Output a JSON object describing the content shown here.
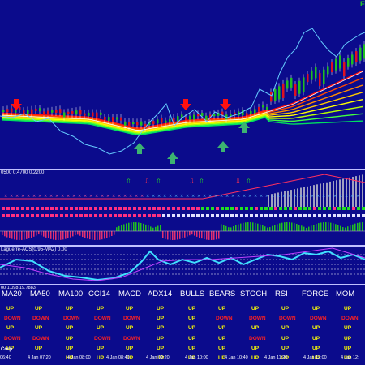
{
  "symbol": "EU",
  "panels": {
    "indicator1_label": "0500 0.4700 0.2200",
    "indicator2_label": "Laguerre-ACS(0.95-MA2) 0.00",
    "table_scale_label": "00 1.098 19.7883"
  },
  "dashboard": {
    "columns": [
      "MA20",
      "MA50",
      "MA100",
      "CCI14",
      "MACD",
      "ADX14",
      "BULLS",
      "BEARS",
      "STOCH",
      "RSI",
      "FORCE",
      "MOM"
    ],
    "rows": [
      [
        "UP",
        "UP",
        "UP",
        "UP",
        "UP",
        "UP",
        "UP",
        "UP",
        "UP",
        "UP",
        "UP",
        "UP"
      ],
      [
        "DOWN",
        "DOWN",
        "DOWN",
        "DOWN",
        "DOWN",
        "UP",
        "UP",
        "DOWN",
        "DOWN",
        "DOWN",
        "DOWN",
        "DOWN"
      ],
      [
        "UP",
        "UP",
        "UP",
        "UP",
        "UP",
        "UP",
        "UP",
        "UP",
        "UP",
        "UP",
        "UP",
        "UP"
      ],
      [
        "DOWN",
        "DOWN",
        "UP",
        "DOWN",
        "DOWN",
        "UP",
        "UP",
        "UP",
        "DOWN",
        "UP",
        "UP",
        "UP"
      ],
      [
        "UP",
        "UP",
        "UP",
        "UP",
        "UP",
        "UP",
        "UP",
        "UP",
        "UP",
        "UP",
        "UP",
        "UP"
      ],
      [
        "UP",
        "UP",
        "UP",
        "UP",
        "UP",
        "UP",
        "UP",
        "UP",
        "UP",
        "UP",
        "UP",
        "UP"
      ]
    ],
    "footer_left": "Corp."
  },
  "time_axis": [
    "06:40",
    "4 Jan 07:20",
    "4 Jan 08:00",
    "4 Jan 08:40",
    "4 Jan 09:20",
    "4 Jan 10:00",
    "4 Jan 10:40",
    "4 Jan 11:20",
    "4 Jan 12:00",
    "4 Jan 12:"
  ],
  "colors": {
    "background": "#0b0b8c",
    "up_text": "#ffff00",
    "down_text": "#ff2020",
    "sell_arrow": "#ff1010",
    "buy_arrow": "#2e8b57"
  }
}
